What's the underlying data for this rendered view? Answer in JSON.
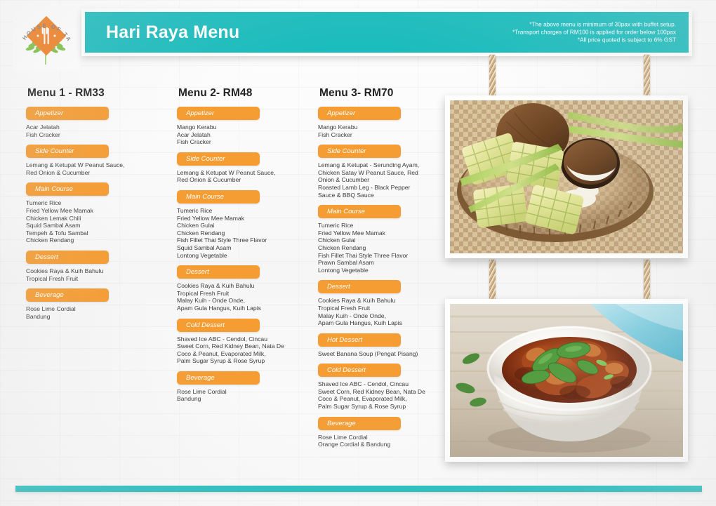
{
  "header": {
    "title": "Hari Raya Menu",
    "notes": [
      "*The above menu is minimum of 30pax with buffet setup.",
      "*Transport charges of RM100 is applied for order below 100pax",
      "*All price quoted is subject to 6% GST"
    ],
    "logo": {
      "name": "house-of-taste-logo",
      "arc_text": "HOUSE OF TASTE"
    }
  },
  "colors": {
    "teal": "#1BBCBD",
    "orange": "#F59C32",
    "logo_orange": "#F07E20",
    "logo_green": "#66B447",
    "text": "#3b3b3b",
    "title": "#222222"
  },
  "menus": [
    {
      "title": "Menu 1 - RM33",
      "sections": [
        {
          "label": "Appetizer",
          "items": [
            "Acar Jelatah",
            "Fish Cracker"
          ]
        },
        {
          "label": "Side Counter",
          "items": [
            "Lemang & Ketupat W Peanut Sauce,",
            "Red Onion & Cucumber"
          ]
        },
        {
          "label": "Main Course",
          "items": [
            "Tumeric Rice",
            "Fried Yellow Mee Mamak",
            "Chicken Lemak Chili",
            "Squid Sambal Asam",
            "Tempeh & Tofu Sambal",
            "Chicken Rendang"
          ]
        },
        {
          "label": "Dessert",
          "items": [
            "Cookies Raya & Kuih Bahulu",
            "Tropical Fresh Fruit"
          ]
        },
        {
          "label": "Beverage",
          "items": [
            "Rose Lime Cordial",
            "Bandung"
          ]
        }
      ]
    },
    {
      "title": "Menu 2- RM48",
      "sections": [
        {
          "label": "Appetizer",
          "items": [
            "Mango Kerabu",
            "Acar Jelatah",
            "Fish Cracker"
          ]
        },
        {
          "label": "Side Counter",
          "items": [
            "Lemang & Ketupat W Peanut Sauce,",
            "Red Onion & Cucumber"
          ]
        },
        {
          "label": "Main Course",
          "items": [
            "Tumeric Rice",
            "Fried Yellow Mee Mamak",
            "Chicken Gulai",
            "Chicken Rendang",
            "Fish Fillet Thai Style Three Flavor",
            "Squid Sambal Asam",
            "Lontong Vegetable"
          ]
        },
        {
          "label": "Dessert",
          "items": [
            "Cookies Raya & Kuih Bahulu",
            "Tropical Fresh Fruit",
            "Malay Kuih - Onde Onde,",
            "Apam Gula Hangus, Kuih Lapis"
          ]
        },
        {
          "label": "Cold Dessert",
          "items": [
            "Shaved Ice ABC - Cendol, Cincau",
            "Sweet Corn, Red Kidney Bean, Nata De",
            "Coco & Peanut, Evaporated Milk,",
            "Palm Sugar Syrup & Rose Syrup"
          ]
        },
        {
          "label": "Beverage",
          "items": [
            "Rose Lime Cordial",
            "Bandung"
          ]
        }
      ]
    },
    {
      "title": "Menu 3- RM70",
      "sections": [
        {
          "label": "Appetizer",
          "items": [
            "Mango Kerabu",
            "Fish Cracker"
          ]
        },
        {
          "label": "Side Counter",
          "items": [
            "Lemang & Ketupat - Serunding Ayam,",
            "Chicken Satay W Peanut Sauce, Red",
            "Onion & Cucumber",
            "Roasted Lamb Leg - Black Pepper",
            "Sauce & BBQ Sauce"
          ]
        },
        {
          "label": "Main Course",
          "items": [
            "Tumeric Rice",
            "Fried Yellow Mee Mamak",
            "Chicken Gulai",
            "Chicken Rendang",
            "Fish Fillet Thai Style Three Flavor",
            "Prawn Sambal Asam",
            "Lontong Vegetable"
          ]
        },
        {
          "label": "Dessert",
          "items": [
            "Cookies Raya & Kuih Bahulu",
            "Tropical Fresh Fruit",
            "Malay Kuih - Onde Onde,",
            "Apam Gula Hangus, Kuih Lapis"
          ]
        },
        {
          "label": "Hot Dessert",
          "items": [
            "Sweet Banana Soup (Pengat Pisang)"
          ]
        },
        {
          "label": "Cold Dessert",
          "items": [
            "Shaved Ice ABC - Cendol, Cincau",
            "Sweet Corn, Red Kidney Bean, Nata De",
            "Coco & Peanut, Evaporated Milk,",
            "Palm Sugar Syrup & Rose Syrup"
          ]
        },
        {
          "label": "Beverage",
          "items": [
            "Rose Lime Cordial",
            "Orange Cordial & Bandung"
          ]
        }
      ]
    }
  ],
  "photos": [
    {
      "name": "ketupat-photo",
      "caption": "Ketupat woven palm pouches with coconut and lemongrass on rattan tray"
    },
    {
      "name": "rendang-bowl-photo",
      "caption": "White bowl of rendang curry garnished with basil on wooden table"
    }
  ]
}
